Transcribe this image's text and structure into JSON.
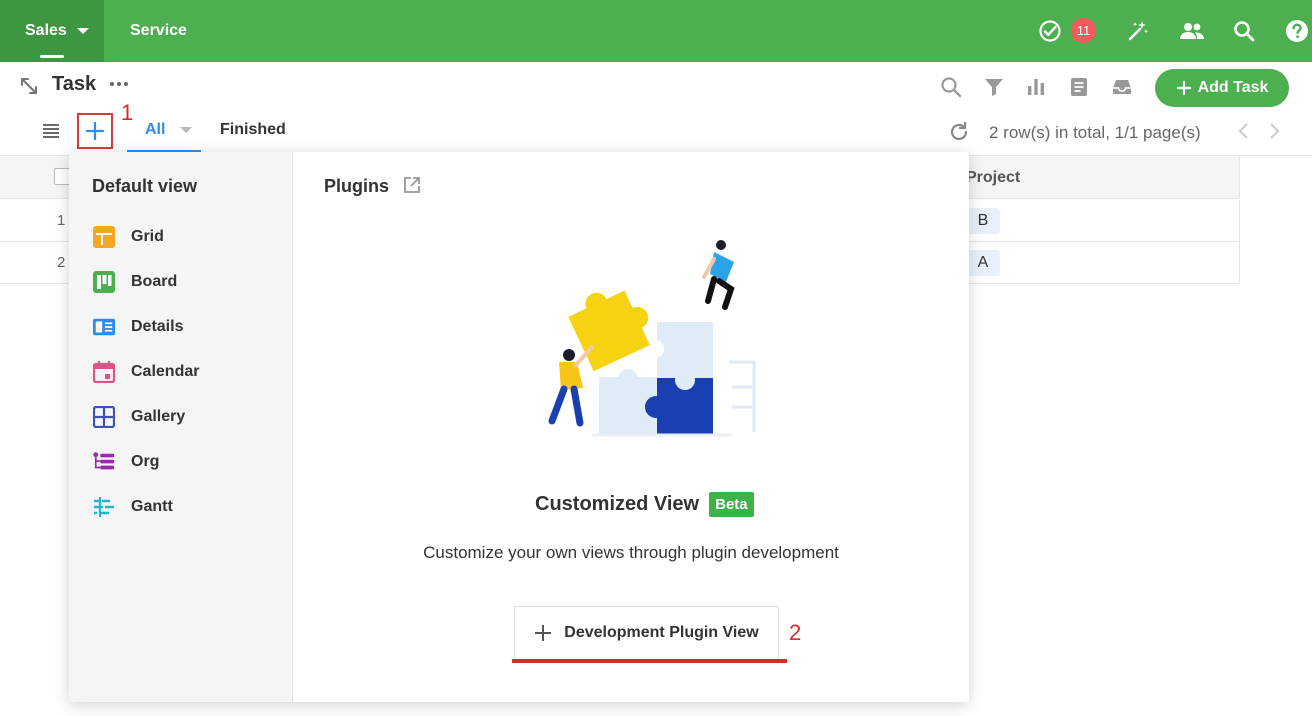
{
  "topbar": {
    "tabs": [
      {
        "label": "Sales"
      },
      {
        "label": "Service"
      }
    ],
    "badge_count": "11"
  },
  "page": {
    "title": "Task",
    "add_task_label": "Add Task",
    "view_tabs": [
      {
        "label": "All"
      },
      {
        "label": "Finished"
      }
    ],
    "rows_info": "2 row(s) in total, 1/1 page(s)",
    "annotation_1": "1",
    "annotation_2": "2"
  },
  "grid": {
    "header_project": "Project",
    "rows": [
      {
        "index": "1",
        "project": "B"
      },
      {
        "index": "2",
        "project": "A"
      }
    ]
  },
  "popup": {
    "default_view_title": "Default view",
    "views": [
      {
        "label": "Grid",
        "icon": "grid-icon",
        "color": "#f5a623"
      },
      {
        "label": "Board",
        "icon": "board-icon",
        "color": "#4caf50"
      },
      {
        "label": "Details",
        "icon": "details-icon",
        "color": "#2d8cf0"
      },
      {
        "label": "Calendar",
        "icon": "calendar-icon",
        "color": "#e84d8a"
      },
      {
        "label": "Gallery",
        "icon": "gallery-icon",
        "color": "#3f51b5"
      },
      {
        "label": "Org",
        "icon": "org-icon",
        "color": "#9c27b0"
      },
      {
        "label": "Gantt",
        "icon": "gantt-icon",
        "color": "#26b5c8"
      }
    ],
    "plugins_title": "Plugins",
    "customized_view_title": "Customized View",
    "beta_label": "Beta",
    "description": "Customize your own views through plugin development",
    "dev_button_label": "Development Plugin View"
  },
  "colors": {
    "brand_green": "#4caf50",
    "accent_blue": "#2d8cf0",
    "annotation_red": "#d82a2a"
  }
}
